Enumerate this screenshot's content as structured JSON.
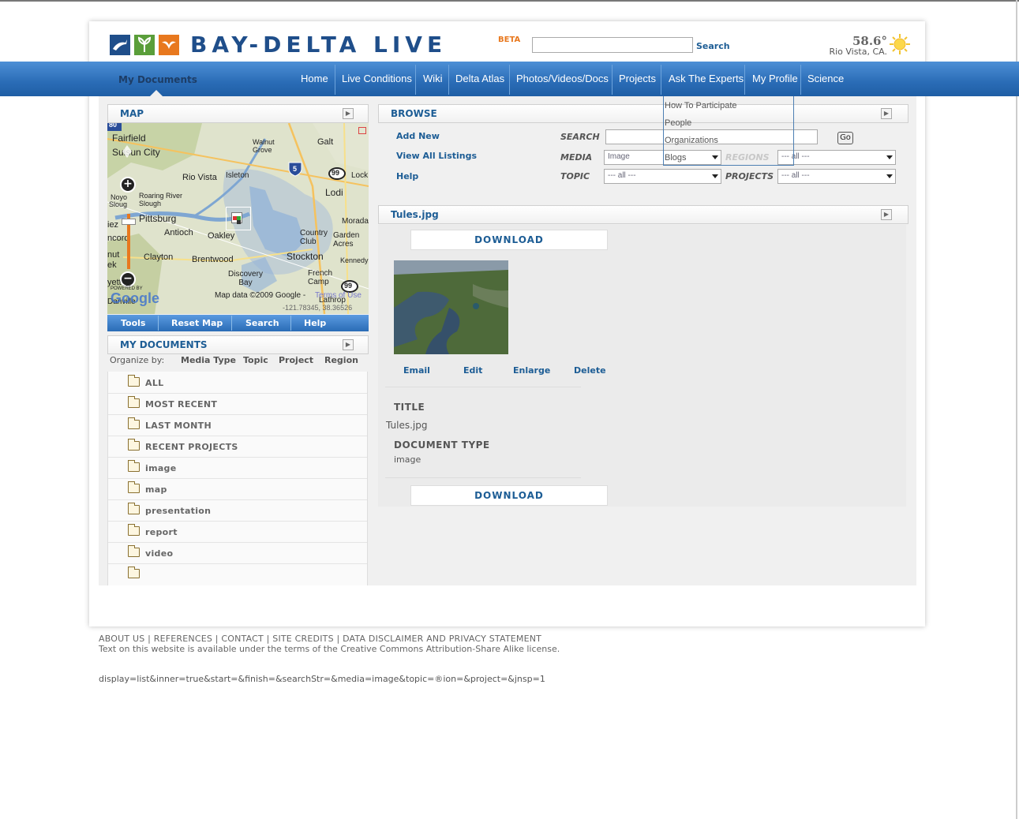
{
  "brand": {
    "logo_text": "BAY-DELTA LIVE",
    "beta": "BETA"
  },
  "header": {
    "search_button": "Search",
    "temperature": "58.6°",
    "location": "Rio Vista, CA."
  },
  "nav": {
    "active_tab": "My Documents",
    "items": [
      "Home",
      "Live Conditions",
      "Wiki",
      "Delta Atlas",
      "Photos/Videos/Docs",
      "Projects",
      "Ask The Experts",
      "My Profile",
      "Science"
    ],
    "experts_menu": [
      "How To Participate",
      "People",
      "Organizations",
      "Blogs"
    ]
  },
  "map_panel": {
    "title": "MAP",
    "labels": [
      "Fairfield",
      "Suisun City",
      "Walnut Grove",
      "Galt",
      "Rio Vista",
      "Isleton",
      "Lock",
      "Lodi",
      "Roaring River Slough",
      "Pittsburg",
      "Antioch",
      "Oakley",
      "Morada",
      "Country Club",
      "Garden Acres",
      "Clayton",
      "Brentwood",
      "Stockton",
      "Kennedy",
      "Discovery Bay",
      "French Camp",
      "Lathrop",
      "Danville",
      "Noyo",
      "Sloug",
      "ncord",
      "nut",
      "ek",
      "yett",
      "iez"
    ],
    "shields": {
      "i5": "5",
      "h99a": "99",
      "h99b": "99",
      "h80": "80"
    },
    "attribution": "Map data ©2009 Google -",
    "terms": "Terms of Use",
    "coords": "-121.78345, 38.36526",
    "powered_by": "POWERED BY",
    "google": "Google",
    "toolbar": [
      "Tools",
      "Reset Map",
      "Search",
      "Help"
    ]
  },
  "my_documents": {
    "title": "MY DOCUMENTS",
    "organize_label": "Organize by:",
    "organize_options": [
      "Media Type",
      "Topic",
      "Project",
      "Region"
    ],
    "folders": [
      "ALL",
      "MOST RECENT",
      "LAST MONTH",
      "RECENT PROJECTS",
      "image",
      "map",
      "presentation",
      "report",
      "video",
      ""
    ]
  },
  "browse": {
    "title": "BROWSE",
    "links": [
      "Add New",
      "View All Listings",
      "Help"
    ],
    "search_label": "SEARCH",
    "search_value": "",
    "go_button": "Go",
    "media_label": "MEDIA",
    "media_value": "Image",
    "regions_label": "REGIONS",
    "regions_value": "--- all ---",
    "topic_label": "TOPIC",
    "topic_value": "--- all ---",
    "projects_label": "PROJECTS",
    "projects_value": "--- all ---"
  },
  "document": {
    "title": "Tules.jpg",
    "download": "DOWNLOAD",
    "actions": [
      "Email",
      "Edit",
      "Enlarge",
      "Delete"
    ],
    "title_label": "TITLE",
    "title_value": "Tules.jpg",
    "type_label": "DOCUMENT TYPE",
    "type_value": "image"
  },
  "footer": {
    "links": [
      "ABOUT US",
      "REFERENCES",
      "CONTACT",
      "SITE CREDITS",
      "DATA DISCLAIMER AND PRIVACY STATEMENT"
    ],
    "license": "Text on this website is available under the terms of the Creative Commons Attribution-Share Alike license.",
    "query": "display=list&inner=true&start=&finish=&searchStr=&media=image&topic=®ion=&project=&jnsp=1"
  },
  "colors": {
    "nav_blue": "#2a6cb6",
    "link_blue": "#1d5d95",
    "beta_orange": "#e8781e"
  }
}
